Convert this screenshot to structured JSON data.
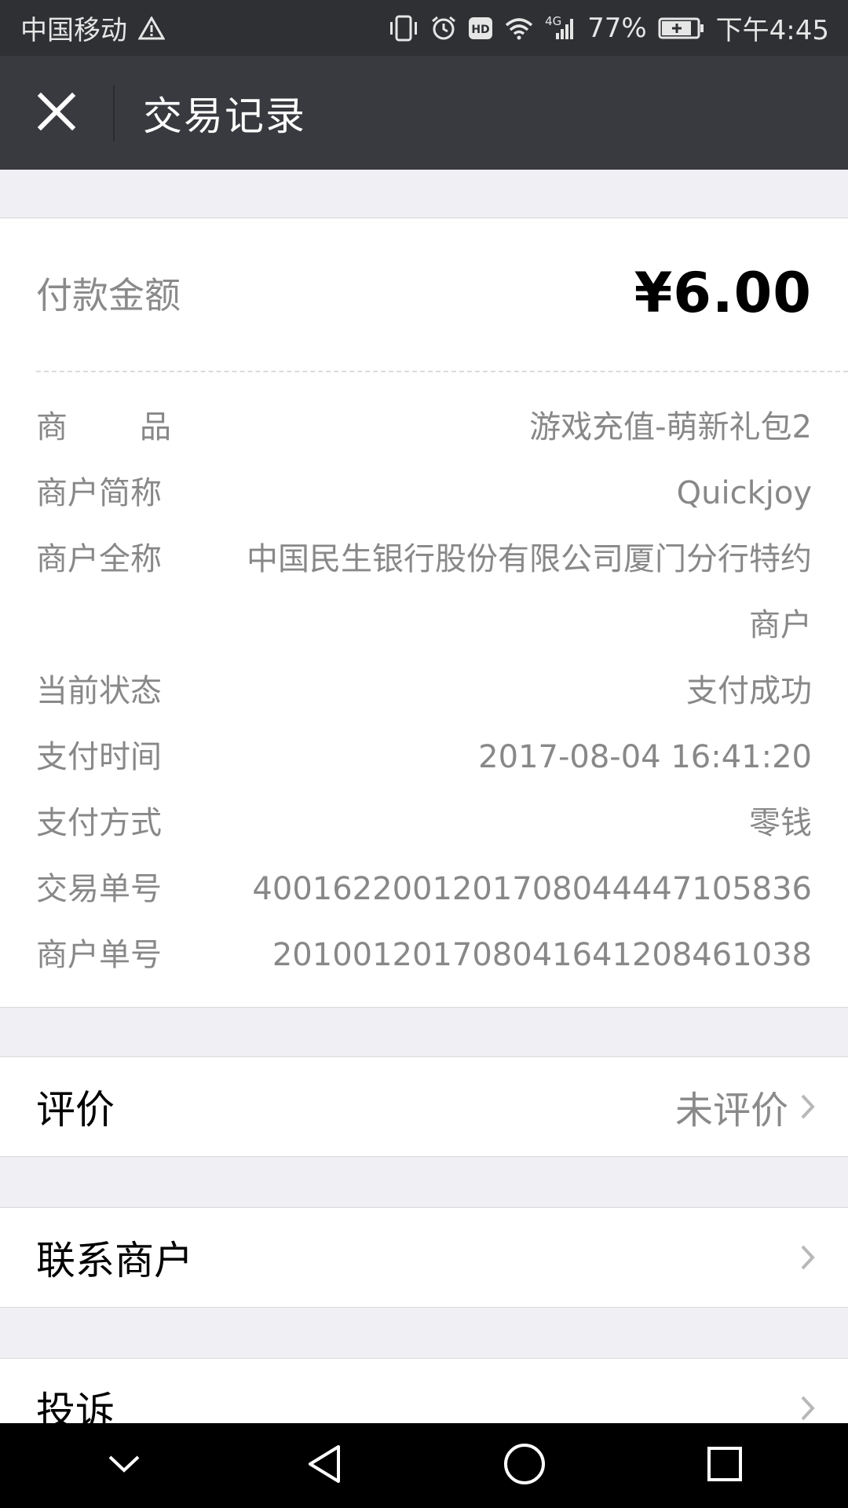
{
  "status_bar": {
    "carrier": "中国移动",
    "network": "4G",
    "battery": "77%",
    "time": "下午4:45",
    "icons": [
      "warning-icon",
      "vibrate-icon",
      "alarm-icon",
      "hd-icon",
      "wifi-icon",
      "signal-icon",
      "battery-icon"
    ]
  },
  "header": {
    "title": "交易记录",
    "close_icon": "close-icon"
  },
  "payment": {
    "amount_label": "付款金额",
    "amount_value": "¥6.00"
  },
  "details": [
    {
      "label_chars": [
        "商",
        "品"
      ],
      "value": "游戏充值-萌新礼包2"
    },
    {
      "label": "商户简称",
      "value": "Quickjoy"
    },
    {
      "label": "商户全称",
      "value": "中国民生银行股份有限公司厦门分行特约商户"
    },
    {
      "label": "当前状态",
      "value": "支付成功"
    },
    {
      "label": "支付时间",
      "value": "2017-08-04 16:41:20"
    },
    {
      "label": "支付方式",
      "value": "零钱"
    },
    {
      "label": "交易单号",
      "value": "4001622001201708044447105836"
    },
    {
      "label": "商户单号",
      "value": "20100120170804164120846103​8"
    }
  ],
  "actions": [
    {
      "label": "评价",
      "status": "未评价"
    },
    {
      "label": "联系商户",
      "status": ""
    },
    {
      "label": "投诉",
      "status": ""
    }
  ],
  "nav_bar": {
    "icons": [
      "hide-keyboard-icon",
      "back-icon",
      "home-icon",
      "recents-icon"
    ]
  },
  "colors": {
    "status_bar_bg": "#2f3034",
    "title_bar_bg": "#393a3f",
    "page_bg": "#efeff4",
    "muted_text": "#888888"
  }
}
